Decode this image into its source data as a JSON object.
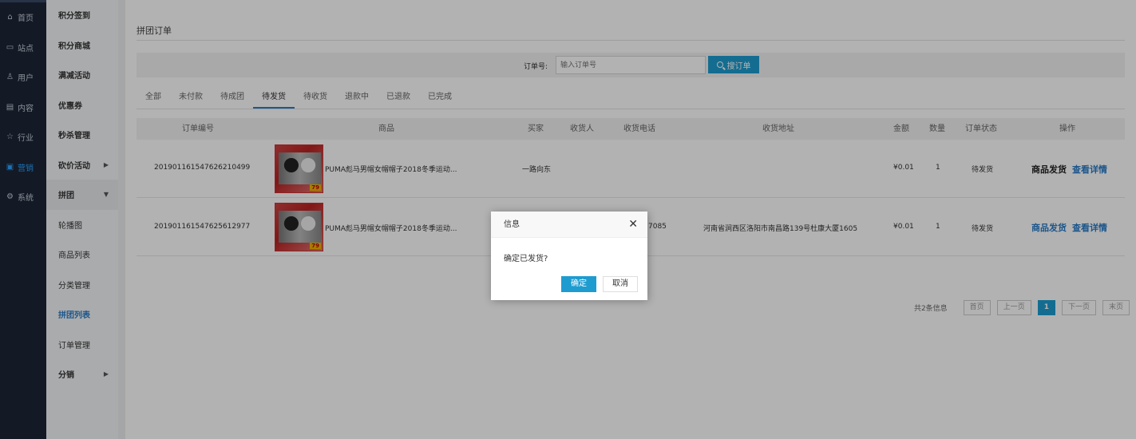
{
  "nav_main": [
    {
      "icon": "home-icon",
      "glyph": "⌂",
      "label": "首页"
    },
    {
      "icon": "monitor-icon",
      "glyph": "▭",
      "label": "站点"
    },
    {
      "icon": "user-icon",
      "glyph": "♙",
      "label": "用户"
    },
    {
      "icon": "content-icon",
      "glyph": "▤",
      "label": "内容"
    },
    {
      "icon": "star-icon",
      "glyph": "☆",
      "label": "行业"
    },
    {
      "icon": "marketing-icon",
      "glyph": "▣",
      "label": "营销"
    },
    {
      "icon": "settings-icon",
      "glyph": "⚙",
      "label": "系统"
    }
  ],
  "nav_sub": [
    {
      "label": "积分签到"
    },
    {
      "label": "积分商城"
    },
    {
      "label": "满减活动"
    },
    {
      "label": "优惠券"
    },
    {
      "label": "秒杀管理"
    },
    {
      "label": "砍价活动",
      "arrow": "▶"
    },
    {
      "label": "拼团",
      "arrow": "▼"
    },
    {
      "label": "轮播图"
    },
    {
      "label": "商品列表"
    },
    {
      "label": "分类管理"
    },
    {
      "label": "拼团列表"
    },
    {
      "label": "订单管理"
    },
    {
      "label": "分销",
      "arrow": "▶"
    }
  ],
  "page": {
    "title": "拼团订单"
  },
  "search": {
    "label": "订单号:",
    "placeholder": "输入订单号",
    "button": "搜订单"
  },
  "tabs": [
    "全部",
    "未付款",
    "待成团",
    "待发货",
    "待收货",
    "退款中",
    "已退款",
    "已完成"
  ],
  "table": {
    "headers": [
      "订单编号",
      "商品",
      "买家",
      "收货人",
      "收货电话",
      "收货地址",
      "金额",
      "数量",
      "订单状态",
      "操作"
    ],
    "rows": [
      {
        "order_no": "20190116154762621049​9",
        "product": "PUMA彪马男帽女帽帽子2018冬季运动...",
        "thumb_badge": "79",
        "buyer": "一路向东",
        "receiver": "",
        "phone": "",
        "address": "",
        "amount": "¥0.01",
        "qty": "1",
        "status": "待发货",
        "action1": "商品发货",
        "action2": "查看详情"
      },
      {
        "order_no": "20190116154762561297​7",
        "product": "PUMA彪马男帽女帽帽子2018冬季运动...",
        "thumb_badge": "79",
        "buyer": "",
        "receiver": "",
        "phone": "7085",
        "address": "河南省涧西区洛阳市南昌路139号杜康大厦1605",
        "amount": "¥0.01",
        "qty": "1",
        "status": "待发货",
        "action1": "商品发货",
        "action2": "查看详情"
      }
    ]
  },
  "pager": {
    "info": "共2条信息",
    "first": "首页",
    "prev": "上一页",
    "current": "1",
    "next": "下一页",
    "last": "末页"
  },
  "dialog": {
    "title": "信息",
    "close": "✕",
    "message": "确定已发货?",
    "confirm": "确定",
    "cancel": "取消"
  },
  "colors": {
    "accent": "#1e9cd0",
    "nav_bg": "#1c2637",
    "active_nav": "#2ba1ff",
    "link": "#2a7cc7"
  }
}
